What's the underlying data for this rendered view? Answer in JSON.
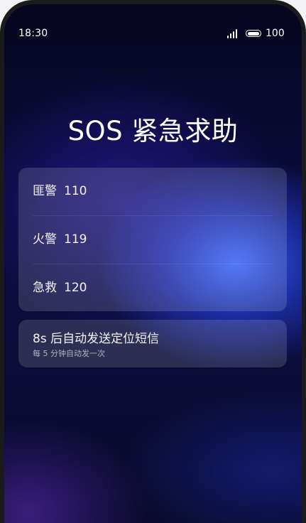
{
  "status_bar": {
    "time": "18:30",
    "battery": "100",
    "battery_level": 1.0
  },
  "title": "SOS 紧急求助",
  "contacts": [
    {
      "name": "匪警",
      "number": "110"
    },
    {
      "name": "火警",
      "number": "119"
    },
    {
      "name": "急救",
      "number": "120"
    }
  ],
  "sms": {
    "title": "8s 后自动发送定位短信",
    "subtitle": "每 5 分钟自动发一次"
  },
  "colors": {
    "accent_glow": "#3a68ff",
    "background_top": "#06061f",
    "text_primary": "#f2f2f7"
  },
  "icons": [
    "signal-icon",
    "battery-icon"
  ]
}
